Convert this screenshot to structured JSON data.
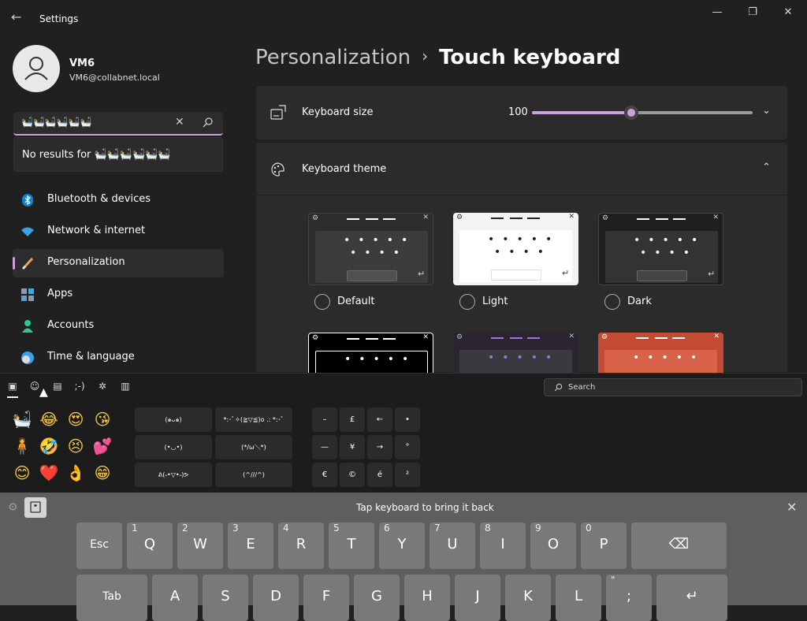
{
  "window": {
    "title": "Settings",
    "controls": {
      "minimize": "—",
      "maximize": "❐",
      "close": "✕"
    }
  },
  "user": {
    "name": "VM6",
    "email": "VM6@collabnet.local"
  },
  "search": {
    "value": "🛀🛀🛀🛀🛀🛀",
    "no_results": "No results for 🛀🛀🛀🛀🛀🛀"
  },
  "nav": {
    "items": [
      {
        "label": "Bluetooth & devices",
        "icon": "bluetooth-icon"
      },
      {
        "label": "Network & internet",
        "icon": "wifi-icon"
      },
      {
        "label": "Personalization",
        "icon": "brush-icon",
        "selected": true
      },
      {
        "label": "Apps",
        "icon": "apps-icon"
      },
      {
        "label": "Accounts",
        "icon": "person-icon"
      },
      {
        "label": "Time & language",
        "icon": "globe-clock-icon"
      }
    ]
  },
  "breadcrumb": {
    "parent": "Personalization",
    "separator": "›",
    "current": "Touch keyboard"
  },
  "keyboard_size": {
    "label": "Keyboard size",
    "value": "100",
    "slider_fraction": 0.45
  },
  "keyboard_theme": {
    "label": "Keyboard theme",
    "options": [
      {
        "label": "Default"
      },
      {
        "label": "Light"
      },
      {
        "label": "Dark"
      }
    ]
  },
  "emoji_panel": {
    "search_placeholder": "Search",
    "emoji": [
      "🛀",
      "😂",
      "😍",
      "😘",
      "🧍",
      "🤣",
      "😣",
      "💕",
      "😊",
      "❤️",
      "👌",
      "😁"
    ],
    "kaomoji": [
      [
        "(๑ᴗ๑)",
        "*:･ﾟ✧(≧▽≦)o .: *:･ﾟ"
      ],
      [
        "(•◡•)",
        "(*/ω＼*)"
      ],
      [
        "ᕕ(˵•▽•˵)ᕗ",
        "(^///^)"
      ]
    ],
    "symbols": [
      [
        "–",
        "£",
        "←",
        "•"
      ],
      [
        "—",
        "¥",
        "→",
        "°"
      ],
      [
        "€",
        "©",
        "é",
        "²"
      ]
    ]
  },
  "touch_keyboard": {
    "message": "Tap keyboard to bring it back",
    "row1": [
      {
        "main": "Esc",
        "sup": ""
      },
      {
        "main": "Q",
        "sup": "1"
      },
      {
        "main": "W",
        "sup": "2"
      },
      {
        "main": "E",
        "sup": "3"
      },
      {
        "main": "R",
        "sup": "4"
      },
      {
        "main": "T",
        "sup": "5"
      },
      {
        "main": "Y",
        "sup": "6"
      },
      {
        "main": "U",
        "sup": "7"
      },
      {
        "main": "I",
        "sup": "8"
      },
      {
        "main": "O",
        "sup": "9"
      },
      {
        "main": "P",
        "sup": "0"
      },
      {
        "main": "⌫",
        "sup": ""
      }
    ],
    "row2": [
      {
        "main": "Tab",
        "sup": ""
      },
      {
        "main": "A",
        "sup": ""
      },
      {
        "main": "S",
        "sup": ""
      },
      {
        "main": "D",
        "sup": ""
      },
      {
        "main": "F",
        "sup": ""
      },
      {
        "main": "G",
        "sup": ""
      },
      {
        "main": "H",
        "sup": ""
      },
      {
        "main": "J",
        "sup": ""
      },
      {
        "main": "K",
        "sup": ""
      },
      {
        "main": "L",
        "sup": ""
      },
      {
        "main": ";",
        "sup": "\""
      },
      {
        "main": "↵",
        "sup": ""
      }
    ]
  },
  "colors": {
    "accent": "#c8a3e0",
    "background": "#202020",
    "card": "#2b2b2b",
    "keyboard": "#5e5e5e",
    "key": "#797979"
  }
}
